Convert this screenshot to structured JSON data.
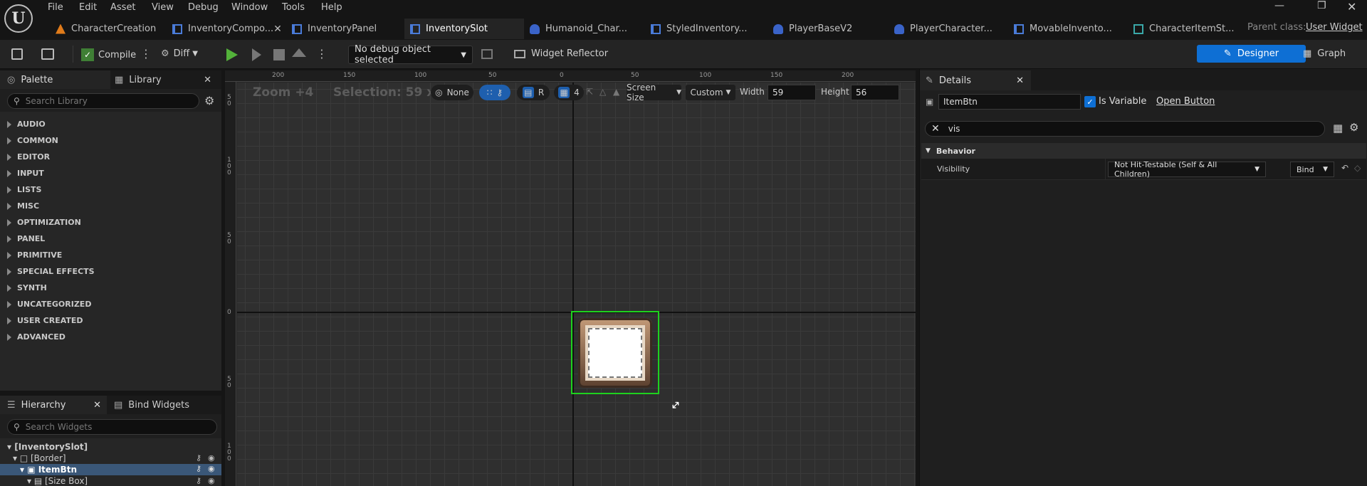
{
  "menu": [
    "File",
    "Edit",
    "Asset",
    "View",
    "Debug",
    "Window",
    "Tools",
    "Help"
  ],
  "tabs": [
    {
      "label": "CharacterCreation",
      "icon": "blueprint-icon",
      "active": false
    },
    {
      "label": "InventoryCompo...",
      "icon": "widget-blueprint-icon",
      "active": false
    },
    {
      "label": "InventoryPanel",
      "icon": "widget-blueprint-icon",
      "active": false
    },
    {
      "label": "InventorySlot",
      "icon": "widget-blueprint-icon",
      "active": true
    },
    {
      "label": "Humanoid_Char...",
      "icon": "character-icon",
      "active": false
    },
    {
      "label": "StyledInventory...",
      "icon": "widget-blueprint-icon",
      "active": false
    },
    {
      "label": "PlayerBaseV2",
      "icon": "character-icon",
      "active": false
    },
    {
      "label": "PlayerCharacter...",
      "icon": "character-icon",
      "active": false
    },
    {
      "label": "MovableInvento...",
      "icon": "widget-blueprint-icon",
      "active": false
    },
    {
      "label": "CharacterItemSt...",
      "icon": "struct-icon",
      "active": false
    }
  ],
  "parent_class": {
    "label": "Parent class:",
    "value": "User Widget"
  },
  "toolbar": {
    "compile": "Compile",
    "diff": "Diff",
    "debug_object": "No debug object selected",
    "widget_reflector": "Widget Reflector",
    "designer": "Designer",
    "graph": "Graph"
  },
  "palette": {
    "tab_palette": "Palette",
    "tab_library": "Library",
    "search_placeholder": "Search Library",
    "categories": [
      "AUDIO",
      "COMMON",
      "EDITOR",
      "INPUT",
      "LISTS",
      "MISC",
      "OPTIMIZATION",
      "PANEL",
      "PRIMITIVE",
      "SPECIAL EFFECTS",
      "SYNTH",
      "UNCATEGORIZED",
      "USER CREATED",
      "ADVANCED"
    ]
  },
  "hierarchy": {
    "tab_hierarchy": "Hierarchy",
    "tab_bind": "Bind Widgets",
    "search_placeholder": "Search Widgets",
    "items": [
      {
        "label": "[InventorySlot]",
        "selected": false
      },
      {
        "label": "[Border]",
        "selected": false
      },
      {
        "label": "ItemBtn",
        "selected": true
      },
      {
        "label": "[Size Box]",
        "selected": false
      }
    ]
  },
  "canvas": {
    "zoom": "Zoom +4",
    "selection": "Selection: 59 x 56",
    "none_label": "None",
    "r_label": "R",
    "grid_value": "4",
    "screen_size": "Screen Size",
    "custom": "Custom",
    "width_label": "Width",
    "width_value": "59",
    "height_label": "Height",
    "height_value": "56",
    "ruler_h": [
      "200",
      "150",
      "100",
      "50",
      "0",
      "50",
      "100",
      "150",
      "200"
    ],
    "ruler_v": [
      "50",
      "100",
      "50",
      "0",
      "50",
      "100"
    ]
  },
  "details": {
    "tab": "Details",
    "name_value": "ItemBtn",
    "is_variable": "Is Variable",
    "open_button": "Open Button",
    "filter_value": "vis",
    "section": "Behavior",
    "prop_label": "Visibility",
    "prop_value": "Not Hit-Testable (Self & All Children)",
    "bind": "Bind"
  },
  "colors": {
    "accent": "#0e6fd4",
    "selection_green": "#1ed21e",
    "play_green": "#53b23a"
  }
}
